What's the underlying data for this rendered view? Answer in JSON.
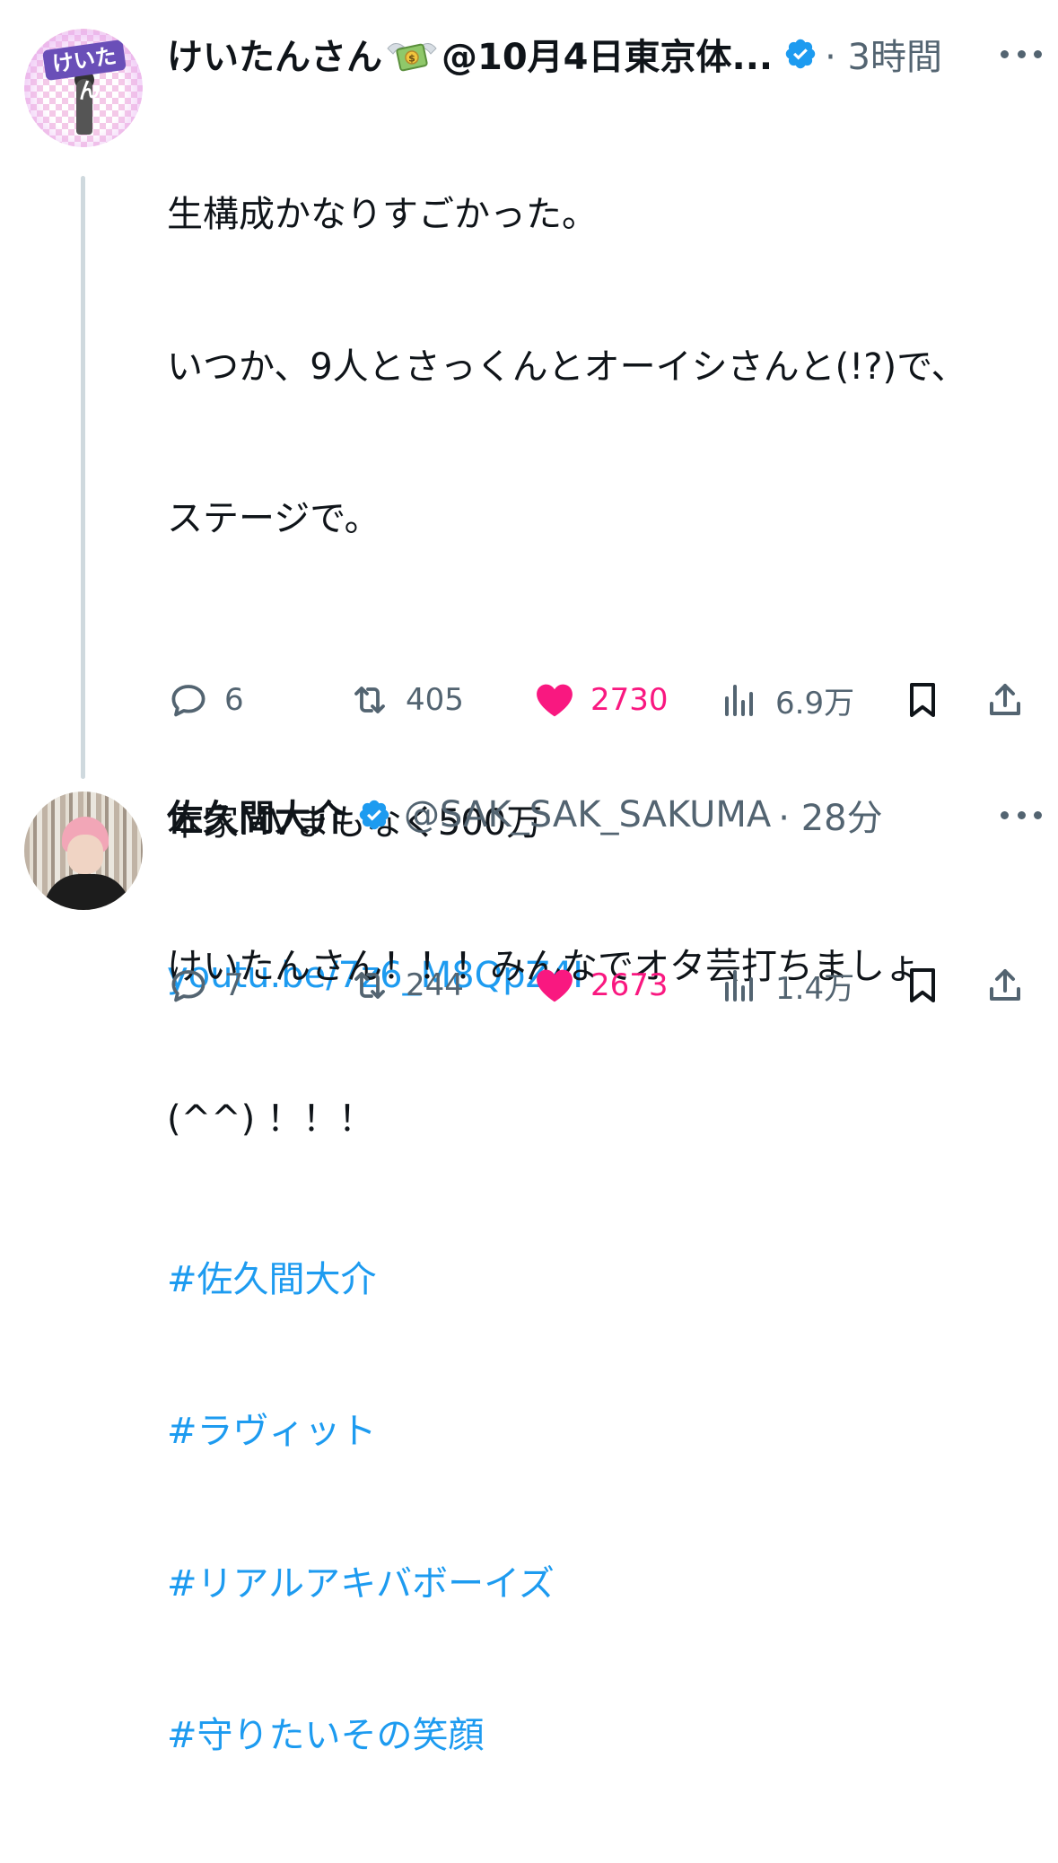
{
  "tweets": [
    {
      "author_name": "けいたんさん",
      "author_name_suffix": "@10月4日東京体...",
      "avatar_text": "けいたん",
      "time": "· 3時間",
      "verified": true,
      "lines": [
        {
          "text": "生構成かなりすごかった。",
          "type": "text"
        },
        {
          "text": "いつか、9人とさっくんとオーイシさんと(!?)で、",
          "type": "text"
        },
        {
          "text": "ステージで。",
          "type": "text"
        },
        {
          "text": "",
          "type": "blank"
        },
        {
          "text": "本家MVまもなく500万",
          "type": "text"
        },
        {
          "text": "youtu.be/7z6_M8QpZ4I",
          "type": "link"
        },
        {
          "text": "",
          "type": "blank"
        },
        {
          "text": "#佐久間大介",
          "type": "link"
        },
        {
          "text": "#ラヴィット",
          "type": "link"
        },
        {
          "text": "#リアルアキバボーイズ",
          "type": "link"
        },
        {
          "text": "#守りたいその笑顔",
          "type": "link"
        }
      ],
      "stats": {
        "replies": "6",
        "retweets": "405",
        "likes": "2730",
        "views": "6.9万"
      }
    },
    {
      "author_name": "佐久間大介",
      "handle": "@SAK_SAK_SAKUMA",
      "time": "· 28分",
      "verified": true,
      "lines": [
        {
          "text": "けいたんさん！！！みんなでオタ芸打ちましょ",
          "type": "text"
        },
        {
          "text": "(^^) ！！！",
          "type": "text"
        }
      ],
      "stats": {
        "replies": "7",
        "retweets": "244",
        "likes": "2673",
        "views": "1.4万"
      }
    }
  ],
  "colors": {
    "link": "#1d9bf0",
    "like": "#f91880",
    "secondary_text": "#536471",
    "verified": "#1d9bf0",
    "thread_line": "#cfd9de"
  },
  "icons": {
    "reply": "reply-icon",
    "retweet": "retweet-icon",
    "like": "heart-icon",
    "views": "views-icon",
    "bookmark": "bookmark-icon",
    "share": "share-icon",
    "more": "more-icon",
    "verified": "verified-badge-icon",
    "money": "money-with-wings-icon"
  }
}
